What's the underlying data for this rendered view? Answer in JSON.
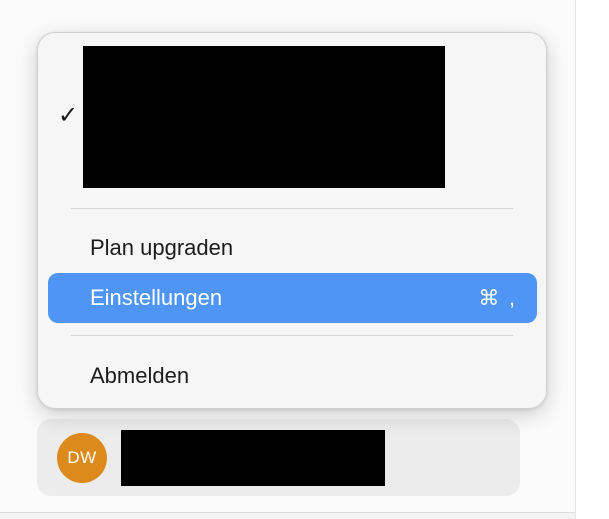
{
  "account_button": {
    "avatar_initials": "DW",
    "avatar_color": "#dd8a1c",
    "name": ""
  },
  "menu": {
    "current_account_checkmark": "✓",
    "items": [
      {
        "label": "Plan upgraden",
        "shortcut": ""
      },
      {
        "label": "Einstellungen",
        "shortcut": "⌘ ,",
        "highlighted": true
      },
      {
        "label": "Abmelden",
        "shortcut": ""
      }
    ],
    "highlight_color": "#4e95f6"
  }
}
